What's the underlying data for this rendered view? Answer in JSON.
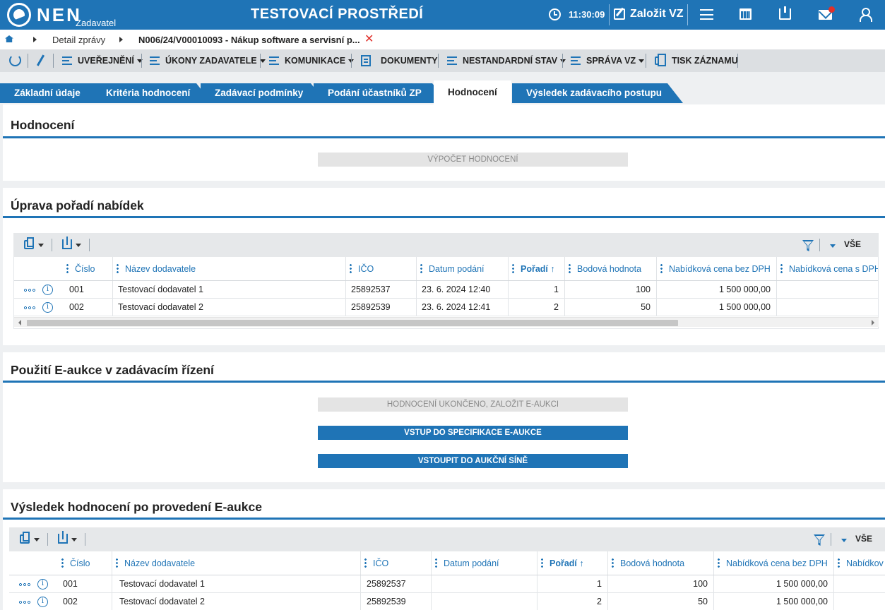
{
  "header": {
    "brand": "NEN",
    "brand_sub": "Zadavatel",
    "env_title": "TESTOVACÍ PROSTŘEDÍ",
    "time": "11:30:09",
    "create_label": "Založit VZ"
  },
  "breadcrumb": {
    "items": [
      "Detail zprávy",
      "N006/24/V00010093 - Nákup software a servisní p..."
    ],
    "close": "✕"
  },
  "toolbar": {
    "uverejneni": "UVEŘEJNĚNÍ",
    "ukony": "ÚKONY ZADAVATELE",
    "komunikace": "KOMUNIKACE",
    "dokumenty": "DOKUMENTY",
    "nestandardni": "NESTANDARDNÍ STAV",
    "sprava": "SPRÁVA VZ",
    "tisk": "TISK ZÁZNAMU"
  },
  "tabs": [
    {
      "label": "Základní údaje"
    },
    {
      "label": "Kritéria hodnocení"
    },
    {
      "label": "Zadávací podmínky"
    },
    {
      "label": "Podání účastníků ZP"
    },
    {
      "label": "Hodnocení"
    },
    {
      "label": "Výsledek zadávacího postupu"
    }
  ],
  "hodnoceni": {
    "title": "Hodnocení",
    "button": "VÝPOČET HODNOCENÍ"
  },
  "uprava": {
    "title": "Úprava pořadí nabídek",
    "vse": "VŠE",
    "columns": {
      "cislo": "Číslo",
      "nazev": "Název dodavatele",
      "ico": "IČO",
      "datum": "Datum podání",
      "poradi": "Pořadí",
      "poradi_sort": "↑",
      "bodova": "Bodová hodnota",
      "bez_dph": "Nabídková cena bez DPH",
      "s_dph": "Nabídková cena s DPH"
    },
    "rows": [
      {
        "cislo": "001",
        "nazev": "Testovací dodavatel 1",
        "ico": "25892537",
        "datum": "23. 6. 2024 12:40",
        "poradi": "1",
        "bodova": "100",
        "bez_dph": "1 500 000,00"
      },
      {
        "cislo": "002",
        "nazev": "Testovací dodavatel 2",
        "ico": "25892539",
        "datum": "23. 6. 2024 12:41",
        "poradi": "2",
        "bodova": "50",
        "bez_dph": "1 500 000,00"
      }
    ]
  },
  "eaukce": {
    "title": "Použití E-aukce v zadávacím řízení",
    "btn_disabled": "HODNOCENÍ UKONČENO, ZALOŽIT E-AUKCI",
    "btn_spec": "VSTUP DO SPECIFIKACE E-AUKCE",
    "btn_sin": "VSTOUPIT DO AUKČNÍ SÍNĚ"
  },
  "vysledek": {
    "title": "Výsledek hodnocení po provedení E-aukce",
    "vse": "VŠE",
    "columns": {
      "cislo": "Číslo",
      "nazev": "Název dodavatele",
      "ico": "IČO",
      "datum": "Datum podání",
      "poradi": "Pořadí",
      "poradi_sort": "↑",
      "bodova": "Bodová hodnota",
      "bez_dph": "Nabídková cena bez DPH",
      "s_dph": "Nabídkov"
    },
    "rows": [
      {
        "cislo": "001",
        "nazev": "Testovací dodavatel 1",
        "ico": "25892537",
        "datum": "",
        "poradi": "1",
        "bodova": "100",
        "bez_dph": "1 500 000,00"
      },
      {
        "cislo": "002",
        "nazev": "Testovací dodavatel 2",
        "ico": "25892539",
        "datum": "",
        "poradi": "2",
        "bodova": "50",
        "bez_dph": "1 500 000,00"
      }
    ]
  },
  "icons": {
    "info": "i"
  }
}
